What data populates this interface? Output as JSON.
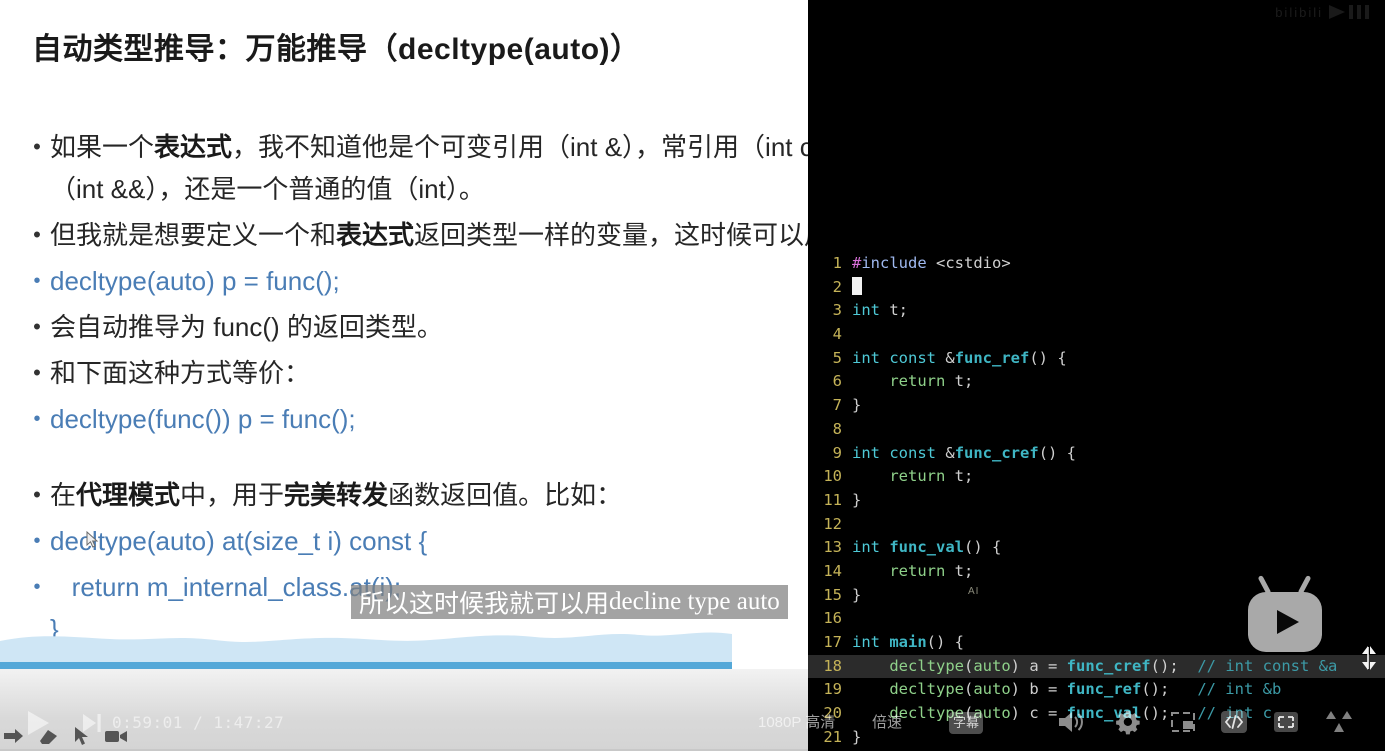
{
  "slide": {
    "title": "自动类型推导：万能推导（decltype(auto)）",
    "bullets": [
      {
        "kind": "text",
        "html": "如果一个<b>表达式</b>，我不知道他是个可变引用（int &），常引用（int const &），右值引用\n（int &&），还是一个普通的值（int）。"
      },
      {
        "kind": "text",
        "html": "但我就是想要定义一个和<b>表达式</b>返回类型一样的变量，这时候可以用："
      },
      {
        "kind": "code",
        "html": "decltype(auto) p = func();"
      },
      {
        "kind": "text",
        "html": "会自动推导为 func() 的返回类型。"
      },
      {
        "kind": "text",
        "html": "和下面这种方式等价："
      },
      {
        "kind": "code",
        "html": "decltype(func()) p = func();"
      },
      {
        "kind": "gap",
        "html": ""
      },
      {
        "kind": "text",
        "html": "在<b>代理模式</b>中，用于<b>完美转发</b>函数返回值。比如："
      },
      {
        "kind": "code",
        "html": "decltype(auto) at(size_t i) const {"
      },
      {
        "kind": "code",
        "html": "   return m_internal_class.at(i);\n}"
      }
    ],
    "accent_color": "#4a7db5",
    "wave_color": "#cfe6f5",
    "wave_line_color": "#54a8d8"
  },
  "editor": {
    "background": "#000000",
    "line_number_color": "#c5b358",
    "highlighted_line": 18,
    "lines": [
      {
        "n": "1",
        "tokens": [
          {
            "t": "#",
            "c": "hash"
          },
          {
            "t": "include",
            "c": "inc"
          },
          {
            "t": " ",
            "c": "plain"
          },
          {
            "t": "<cstdio>",
            "c": "str"
          }
        ]
      },
      {
        "n": "2",
        "tokens": [
          {
            "t": "",
            "c": "cursor"
          }
        ]
      },
      {
        "n": "3",
        "tokens": [
          {
            "t": "int",
            "c": "cyan"
          },
          {
            "t": " t;",
            "c": "plain"
          }
        ]
      },
      {
        "n": "4",
        "tokens": []
      },
      {
        "n": "5",
        "tokens": [
          {
            "t": "int",
            "c": "cyan"
          },
          {
            "t": " ",
            "c": "plain"
          },
          {
            "t": "const",
            "c": "cyan"
          },
          {
            "t": " &",
            "c": "plain"
          },
          {
            "t": "func_ref",
            "c": "teal"
          },
          {
            "t": "() {",
            "c": "plain"
          }
        ]
      },
      {
        "n": "6",
        "tokens": [
          {
            "t": "    ",
            "c": "plain"
          },
          {
            "t": "return",
            "c": "green"
          },
          {
            "t": " t;",
            "c": "plain"
          }
        ]
      },
      {
        "n": "7",
        "tokens": [
          {
            "t": "}",
            "c": "plain"
          }
        ]
      },
      {
        "n": "8",
        "tokens": []
      },
      {
        "n": "9",
        "tokens": [
          {
            "t": "int",
            "c": "cyan"
          },
          {
            "t": " ",
            "c": "plain"
          },
          {
            "t": "const",
            "c": "cyan"
          },
          {
            "t": " &",
            "c": "plain"
          },
          {
            "t": "func_cref",
            "c": "teal"
          },
          {
            "t": "() {",
            "c": "plain"
          }
        ]
      },
      {
        "n": "10",
        "tokens": [
          {
            "t": "    ",
            "c": "plain"
          },
          {
            "t": "return",
            "c": "green"
          },
          {
            "t": " t;",
            "c": "plain"
          }
        ]
      },
      {
        "n": "11",
        "tokens": [
          {
            "t": "}",
            "c": "plain"
          }
        ]
      },
      {
        "n": "12",
        "tokens": []
      },
      {
        "n": "13",
        "tokens": [
          {
            "t": "int",
            "c": "cyan"
          },
          {
            "t": " ",
            "c": "plain"
          },
          {
            "t": "func_val",
            "c": "teal"
          },
          {
            "t": "() {",
            "c": "plain"
          }
        ]
      },
      {
        "n": "14",
        "tokens": [
          {
            "t": "    ",
            "c": "plain"
          },
          {
            "t": "return",
            "c": "green"
          },
          {
            "t": " t;",
            "c": "plain"
          }
        ]
      },
      {
        "n": "15",
        "tokens": [
          {
            "t": "}",
            "c": "plain"
          }
        ]
      },
      {
        "n": "16",
        "tokens": []
      },
      {
        "n": "17",
        "tokens": [
          {
            "t": "int",
            "c": "cyan"
          },
          {
            "t": " ",
            "c": "plain"
          },
          {
            "t": "main",
            "c": "teal"
          },
          {
            "t": "() {",
            "c": "plain"
          }
        ]
      },
      {
        "n": "18",
        "tokens": [
          {
            "t": "    ",
            "c": "plain"
          },
          {
            "t": "decltype",
            "c": "green"
          },
          {
            "t": "(",
            "c": "plain"
          },
          {
            "t": "auto",
            "c": "green"
          },
          {
            "t": ") a = ",
            "c": "plain"
          },
          {
            "t": "func_cref",
            "c": "teal"
          },
          {
            "t": "();  ",
            "c": "plain"
          },
          {
            "t": "// int const &a",
            "c": "cmt"
          }
        ]
      },
      {
        "n": "19",
        "tokens": [
          {
            "t": "    ",
            "c": "plain"
          },
          {
            "t": "decltype",
            "c": "green"
          },
          {
            "t": "(",
            "c": "plain"
          },
          {
            "t": "auto",
            "c": "green"
          },
          {
            "t": ") b = ",
            "c": "plain"
          },
          {
            "t": "func_ref",
            "c": "teal"
          },
          {
            "t": "();   ",
            "c": "plain"
          },
          {
            "t": "// int &b",
            "c": "cmt"
          }
        ]
      },
      {
        "n": "20",
        "tokens": [
          {
            "t": "    ",
            "c": "plain"
          },
          {
            "t": "decltype",
            "c": "green"
          },
          {
            "t": "(",
            "c": "plain"
          },
          {
            "t": "auto",
            "c": "green"
          },
          {
            "t": ") c = ",
            "c": "plain"
          },
          {
            "t": "func_val",
            "c": "teal"
          },
          {
            "t": "();   ",
            "c": "plain"
          },
          {
            "t": "// int c",
            "c": "cmt"
          }
        ]
      },
      {
        "n": "21",
        "tokens": [
          {
            "t": "}",
            "c": "plain"
          }
        ]
      }
    ]
  },
  "subtitle": {
    "chinese": "所以这时候我就可以用",
    "english": "decline type auto",
    "ai_badge": "AI"
  },
  "player": {
    "time_current": "0:59:01",
    "time_separator": "/",
    "time_total": "1:47:27",
    "time_display": "0:59:01  /  1:47:27",
    "quality_label": "1080P 高清",
    "speed_label": "倍速",
    "subtitle_label": "字幕",
    "icons": {
      "play": "play-icon",
      "next": "next-episode-icon",
      "volume": "volume-icon",
      "settings": "gear-icon",
      "pip": "picture-in-picture-icon",
      "web_fullscreen": "web-fullscreen-icon",
      "fullscreen": "fullscreen-icon",
      "widescreen": "widescreen-icon"
    }
  },
  "tools": {
    "items": [
      "pen-tool-icon",
      "eraser-tool-icon",
      "pointer-tool-icon",
      "record-tool-icon"
    ]
  },
  "watermark": {
    "site": "bilibili",
    "logo": "bilibili-tv-logo"
  }
}
